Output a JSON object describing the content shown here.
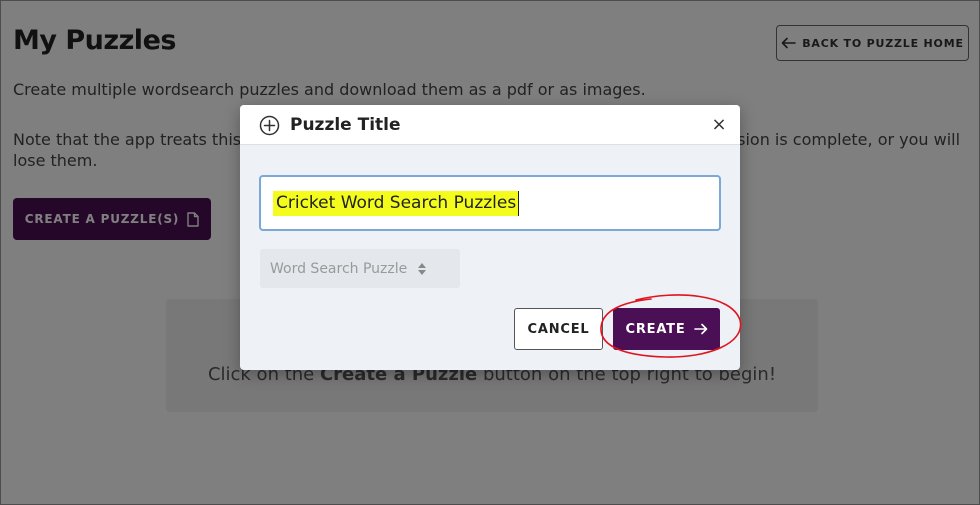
{
  "page": {
    "title": "My Puzzles",
    "back_button_label": "BACK TO PUZZLE HOME",
    "intro": "Create multiple wordsearch puzzles and download them as a pdf or as images.",
    "note": "Note that the app treats this as a session, download the puzzles you create before the session is complete, or you will lose them.",
    "create_puzzle_label": "CREATE A PUZZLE(S)",
    "empty_prefix": "Click on the ",
    "empty_bold": "Create a Puzzle",
    "empty_suffix": " button on the top right to begin!"
  },
  "modal": {
    "title": "Puzzle Title",
    "close_glyph": "×",
    "title_input_value": "Cricket Word Search Puzzles",
    "type_select_value": "Word Search Puzzle",
    "cancel_label": "CANCEL",
    "create_label": "CREATE"
  },
  "colors": {
    "brand_purple": "#4b0f55",
    "highlight_yellow": "#f4fc1c",
    "annotation_red": "#e0141e",
    "input_focus_border": "#7aa9d8"
  },
  "icons": {
    "back": "arrow-left-icon",
    "document": "document-icon",
    "modal_header": "plus-circle-icon",
    "close": "close-icon",
    "select": "updown-chevron-icon",
    "create": "arrow-right-icon"
  }
}
